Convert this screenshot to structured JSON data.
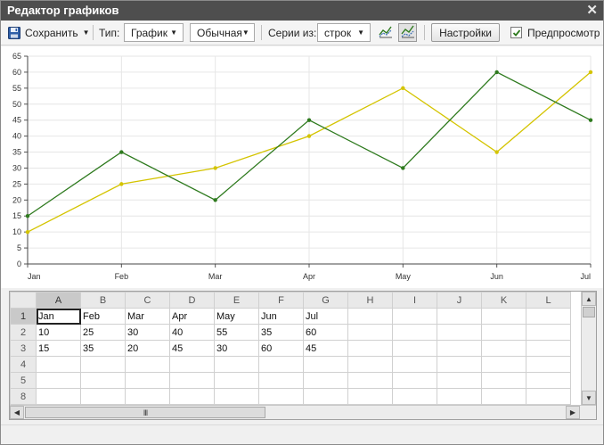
{
  "window": {
    "title": "Редактор графиков",
    "close_glyph": "✕"
  },
  "toolbar": {
    "save_label": "Сохранить",
    "type_label": "Тип:",
    "type_value": "График",
    "subtype_value": "Обычная",
    "series_label": "Серии из:",
    "series_value": "строк",
    "settings_label": "Настройки",
    "preview_label": "Предпросмотр",
    "preview_checked": true,
    "icons": [
      "save-icon",
      "series-rows-icon",
      "series-columns-icon"
    ]
  },
  "chart_data": {
    "type": "line",
    "categories": [
      "Jan",
      "Feb",
      "Mar",
      "Apr",
      "May",
      "Jun",
      "Jul"
    ],
    "yticks": [
      "0",
      "5",
      "10",
      "15",
      "20",
      "25",
      "30",
      "35",
      "40",
      "45",
      "50",
      "55",
      "60",
      "65"
    ],
    "ylim": [
      0,
      65
    ],
    "grid": true,
    "legend": "none",
    "series": [
      {
        "values": [
          10,
          25,
          30,
          40,
          55,
          35,
          60
        ],
        "color": "#d4c400"
      },
      {
        "values": [
          15,
          35,
          20,
          45,
          30,
          60,
          45
        ],
        "color": "#2e7a1e"
      }
    ]
  },
  "sheet": {
    "columns": [
      "A",
      "B",
      "C",
      "D",
      "E",
      "F",
      "G",
      "H",
      "I",
      "J",
      "K",
      "L"
    ],
    "rows": [
      {
        "num": "1",
        "cells": [
          "Jan",
          "Feb",
          "Mar",
          "Apr",
          "May",
          "Jun",
          "Jul",
          "",
          "",
          "",
          "",
          ""
        ]
      },
      {
        "num": "2",
        "cells": [
          "10",
          "25",
          "30",
          "40",
          "55",
          "35",
          "60",
          "",
          "",
          "",
          "",
          ""
        ]
      },
      {
        "num": "3",
        "cells": [
          "15",
          "35",
          "20",
          "45",
          "30",
          "60",
          "45",
          "",
          "",
          "",
          "",
          ""
        ]
      },
      {
        "num": "4",
        "cells": [
          "",
          "",
          "",
          "",
          "",
          "",
          "",
          "",
          "",
          "",
          "",
          ""
        ]
      },
      {
        "num": "5",
        "cells": [
          "",
          "",
          "",
          "",
          "",
          "",
          "",
          "",
          "",
          "",
          "",
          ""
        ]
      },
      {
        "num": "8",
        "cells": [
          "",
          "",
          "",
          "",
          "",
          "",
          "",
          "",
          "",
          "",
          "",
          ""
        ]
      }
    ],
    "scroll_thumb_glyph": "III"
  }
}
